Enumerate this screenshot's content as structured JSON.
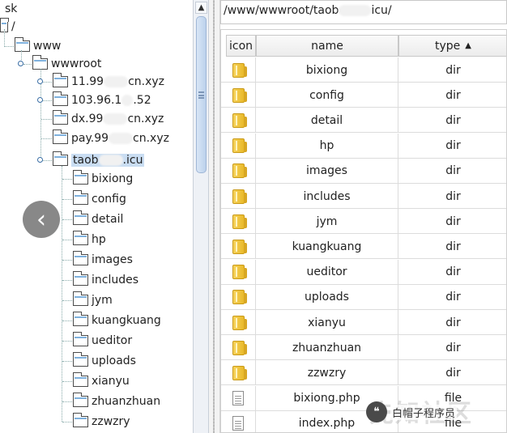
{
  "tree": {
    "top_partial": "sk",
    "root": "/",
    "www": "www",
    "wwwroot": "wwwroot",
    "sites": [
      {
        "prefix": "11.99",
        "suffix": "cn.xyz"
      },
      {
        "prefix": "103.96.1",
        "suffix": ".52"
      },
      {
        "prefix": "dx.99",
        "suffix": "cn.xyz"
      },
      {
        "prefix": "pay.99",
        "suffix": "cn.xyz"
      },
      {
        "prefix": "taob",
        "suffix": ".icu"
      }
    ],
    "children": [
      "bixiong",
      "config",
      "detail",
      "hp",
      "images",
      "includes",
      "jym",
      "kuangkuang",
      "ueditor",
      "uploads",
      "xianyu",
      "zhuanzhuan",
      "zzwzry"
    ],
    "back_glyph": "‹"
  },
  "path_bar": {
    "prefix": "/www/wwwroot/taob",
    "suffix": "icu/"
  },
  "table": {
    "columns": {
      "icon": "icon",
      "name": "name",
      "type": "type"
    },
    "sort_indicator": "▲",
    "rows": [
      {
        "name": "bixiong",
        "type": "dir",
        "icon": "folder-icon"
      },
      {
        "name": "config",
        "type": "dir",
        "icon": "folder-icon"
      },
      {
        "name": "detail",
        "type": "dir",
        "icon": "folder-icon"
      },
      {
        "name": "hp",
        "type": "dir",
        "icon": "folder-icon"
      },
      {
        "name": "images",
        "type": "dir",
        "icon": "folder-icon"
      },
      {
        "name": "includes",
        "type": "dir",
        "icon": "folder-icon"
      },
      {
        "name": "jym",
        "type": "dir",
        "icon": "folder-icon"
      },
      {
        "name": "kuangkuang",
        "type": "dir",
        "icon": "folder-icon"
      },
      {
        "name": "ueditor",
        "type": "dir",
        "icon": "folder-icon"
      },
      {
        "name": "uploads",
        "type": "dir",
        "icon": "folder-icon"
      },
      {
        "name": "xianyu",
        "type": "dir",
        "icon": "folder-icon"
      },
      {
        "name": "zhuanzhuan",
        "type": "dir",
        "icon": "folder-icon"
      },
      {
        "name": "zzwzry",
        "type": "dir",
        "icon": "folder-icon"
      },
      {
        "name": "bixiong.php",
        "type": "file",
        "icon": "file-icon"
      },
      {
        "name": "index.php",
        "type": "file",
        "icon": "file-icon"
      }
    ]
  },
  "watermark": {
    "faint": "先知社区",
    "text": "白帽子程序员",
    "logo_glyph": "❝"
  }
}
